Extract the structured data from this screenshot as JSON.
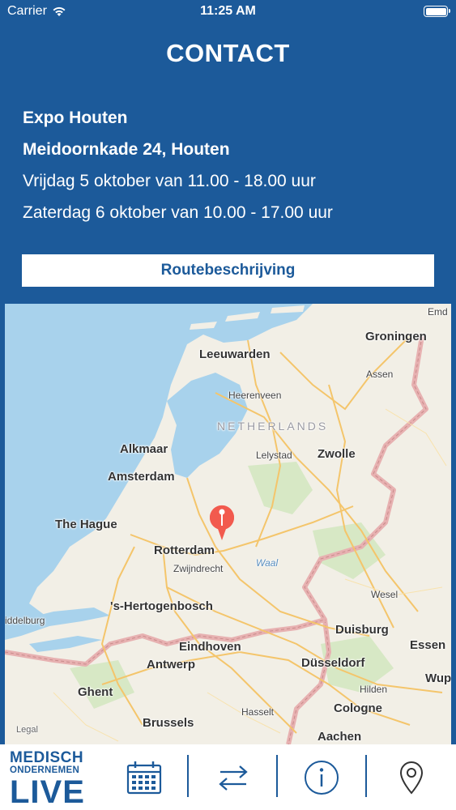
{
  "status_bar": {
    "carrier": "Carrier",
    "time": "11:25 AM"
  },
  "header": {
    "title": "CONTACT"
  },
  "event": {
    "venue": "Expo Houten",
    "address": "Meidoornkade 24, Houten",
    "dates": [
      "Vrijdag 5 oktober van 11.00 - 18.00 uur",
      "Zaterdag 6 oktober van 10.00 - 17.00 uur"
    ]
  },
  "route_button": {
    "label": "Routebeschrijving"
  },
  "map": {
    "country": "NETHERLANDS",
    "cities": {
      "groningen": "Groningen",
      "leeuwarden": "Leeuwarden",
      "assen": "Assen",
      "heerenveen": "Heerenveen",
      "alkmaar": "Alkmaar",
      "lelystad": "Lelystad",
      "zwolle": "Zwolle",
      "amsterdam": "Amsterdam",
      "the_hague": "The Hague",
      "rotterdam": "Rotterdam",
      "zwijndrecht": "Zwijndrecht",
      "hertogenbosch": "'s-Hertogenbosch",
      "middelburg": "iddelburg",
      "wesel": "Wesel",
      "duisburg": "Duisburg",
      "essen": "Essen",
      "eindhoven": "Eindhoven",
      "antwerp": "Antwerp",
      "dusseldorf": "Düsseldorf",
      "wup": "Wup",
      "ghent": "Ghent",
      "hilden": "Hilden",
      "cologne": "Cologne",
      "hasselt": "Hasselt",
      "brussels": "Brussels",
      "aachen": "Aachen",
      "emd": "Emd"
    },
    "water": "Waal",
    "legal": "Legal"
  },
  "tab_bar": {
    "logo": {
      "line1": "MEDISCH",
      "line2": "ONDERNEMEN",
      "line3": "LIVE"
    },
    "icons": [
      "calendar-icon",
      "swap-arrows-icon",
      "info-icon",
      "location-pin-icon"
    ],
    "accent": "#1c5a9a"
  }
}
